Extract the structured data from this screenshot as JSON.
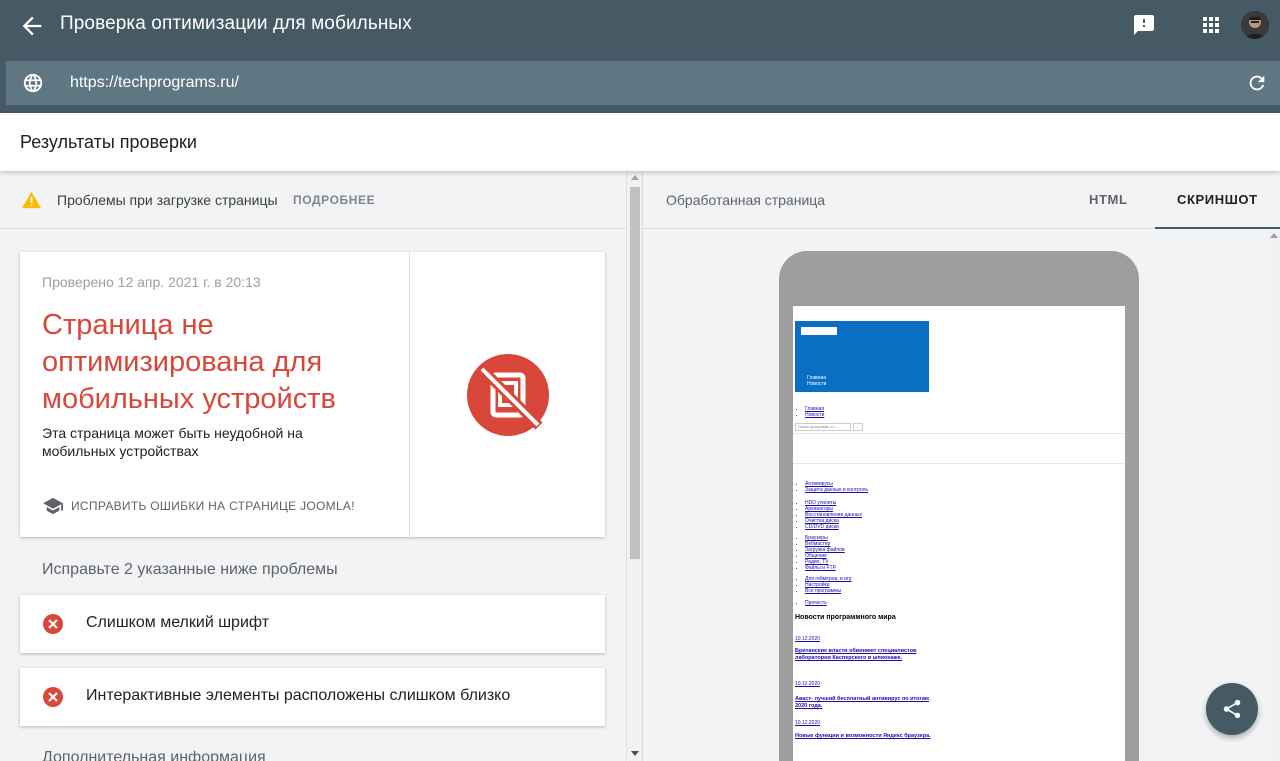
{
  "appbar": {
    "title": "Проверка оптимизации для мобильных",
    "icons": {
      "back": "arrow-back-icon",
      "feedback": "feedback-icon",
      "apps": "apps-grid-icon",
      "avatar": "user-avatar"
    }
  },
  "urlbar": {
    "url": "https://techprograms.ru/",
    "icons": {
      "globe": "globe-icon",
      "reload": "reload-icon"
    }
  },
  "results": {
    "title": "Результаты проверки"
  },
  "load_issues": {
    "text": "Проблемы при загрузке страницы",
    "more_label": "ПОДРОБНЕЕ",
    "icon": "warning-icon"
  },
  "verdict": {
    "checked": "Проверено 12 апр. 2021 г. в 20:13",
    "title": "Страница не оптимизирована для мобильных устройств",
    "description": "Эта страница может быть неудобной на мобильных устройствах",
    "fix_link": "ИСПРАВИТЬ ОШИБКИ НА СТРАНИЦЕ JOOMLA!",
    "icon": "not-mobile-friendly-icon",
    "accent_color": "#d9473a"
  },
  "problems": {
    "heading": "Исправьте 2 указанные ниже проблемы",
    "items": [
      {
        "label": "Слишком мелкий шрифт",
        "icon": "error-icon"
      },
      {
        "label": "Интерактивные элементы расположены слишком близко",
        "icon": "error-icon"
      }
    ]
  },
  "extra": {
    "heading": "Дополнительная информация"
  },
  "right": {
    "rendered_label": "Обработанная страница",
    "tabs": [
      {
        "label": "HTML",
        "active": false
      },
      {
        "label": "СКРИНШОТ",
        "active": true
      }
    ]
  },
  "preview": {
    "header_links": [
      "Главная",
      "Новости"
    ],
    "nav_links": [
      "Главная",
      "Новости"
    ],
    "search_placeholder": "Поиск программ, ст...",
    "search_button": "...",
    "menu_groups": [
      [
        "Антивирусы",
        "Защита данных и контроль"
      ],
      [
        "HDD утилиты",
        "Архиваторы",
        "Восстановление данных",
        "Очистка диска",
        "CD/DVD диски"
      ],
      [
        "Браузеры",
        "Вебмастер",
        "Загрузка файлов",
        "Общение",
        "Радио, TV",
        "Файлы и FTP"
      ],
      [
        "Для геймеров, и игр",
        "Настройки",
        "Все программы"
      ],
      [
        "Прочесть"
      ]
    ],
    "news_title": "Новости программного мира",
    "news": [
      {
        "date": "10.12.2020",
        "title": "Британские власти обвиняют специалистов лаборатории Касперского в шпионаже."
      },
      {
        "date": "10.12.2020",
        "title": "Аваст- лучший бесплатный антивирус по итогам 2020 года."
      },
      {
        "date": "10.12.2020",
        "title": "Новые функции и возможности Яндекс браузера."
      }
    ]
  },
  "fab": {
    "icon": "share-icon"
  },
  "colors": {
    "appbar": "#455a64",
    "urlbar": "#5f7783",
    "error": "#d9473a",
    "warning": "#fbbc04"
  }
}
